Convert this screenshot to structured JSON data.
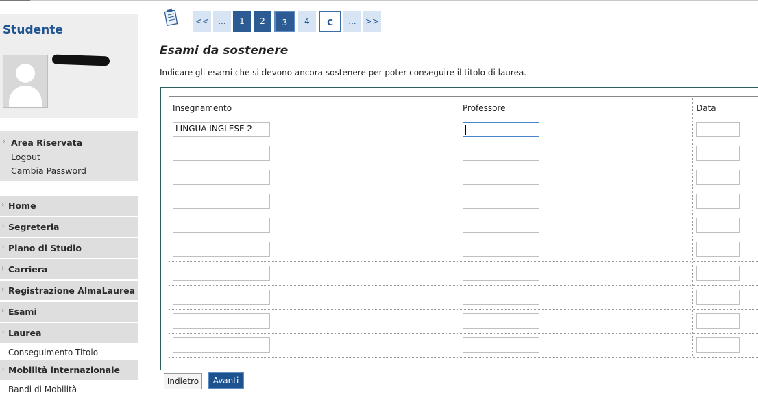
{
  "sidebar": {
    "student_title": "Studente",
    "area": [
      "Area Riservata",
      "Logout",
      "Cambia Password"
    ],
    "nav": [
      {
        "label": "Home"
      },
      {
        "label": "Segreteria"
      },
      {
        "label": "Piano di Studio"
      },
      {
        "label": "Carriera"
      },
      {
        "label": "Registrazione AlmaLaurea"
      },
      {
        "label": "Esami"
      },
      {
        "label": "Laurea"
      }
    ],
    "sub_laurea": "Conseguimento Titolo",
    "mobility": "Mobilità internazionale",
    "sub_mobility": "Bandi di Mobilità"
  },
  "pager": [
    "<<",
    "...",
    "1",
    "2",
    "3",
    "4",
    "C",
    "...",
    ">>"
  ],
  "page_title": "Esami da sostenere",
  "instructions": "Indicare gli esami che si devono ancora sostenere per poter conseguire il titolo di laurea.",
  "table": {
    "headers": [
      "Insegnamento",
      "Professore",
      "Data"
    ],
    "first_row_insegnamento": "LINGUA INGLESE 2"
  },
  "buttons": {
    "back": "Indietro",
    "next": "Avanti"
  },
  "colors": {
    "brand_blue": "#1f5391",
    "pager_bg": "#d6e4f3",
    "pager_active": "#2c5c93"
  }
}
